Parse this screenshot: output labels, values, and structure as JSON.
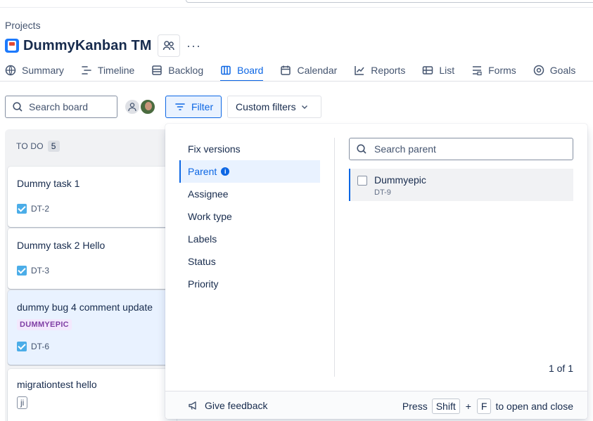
{
  "header": {
    "breadcrumb": "Projects",
    "project_title": "DummyKanban TM",
    "more_label": "···"
  },
  "tabs": [
    {
      "label": "Summary",
      "icon": "globe-icon"
    },
    {
      "label": "Timeline",
      "icon": "timeline-icon"
    },
    {
      "label": "Backlog",
      "icon": "backlog-icon"
    },
    {
      "label": "Board",
      "icon": "board-icon",
      "active": true
    },
    {
      "label": "Calendar",
      "icon": "calendar-icon"
    },
    {
      "label": "Reports",
      "icon": "chart-line-icon"
    },
    {
      "label": "List",
      "icon": "list-icon"
    },
    {
      "label": "Forms",
      "icon": "forms-icon"
    },
    {
      "label": "Goals",
      "icon": "target-icon"
    }
  ],
  "toolbar": {
    "search_placeholder": "Search board",
    "filter_label": "Filter",
    "custom_filters_label": "Custom filters"
  },
  "column": {
    "name": "TO DO",
    "count": "5",
    "cards": [
      {
        "title": "Dummy task 1",
        "key": "DT-2"
      },
      {
        "title": "Dummy task 2 Hello",
        "key": "DT-3"
      },
      {
        "title": "dummy bug 4 comment update",
        "epic": "DUMMYEPIC",
        "key": "DT-6"
      },
      {
        "title": "migrationtest hello",
        "label": "ji"
      }
    ]
  },
  "filter_panel": {
    "menu": [
      {
        "label": "Fix versions"
      },
      {
        "label": "Parent",
        "active": true
      },
      {
        "label": "Assignee"
      },
      {
        "label": "Work type"
      },
      {
        "label": "Labels"
      },
      {
        "label": "Status"
      },
      {
        "label": "Priority"
      }
    ],
    "search_placeholder": "Search parent",
    "options": [
      {
        "name": "Dummyepic",
        "key": "DT-9"
      }
    ],
    "pagination": "1 of 1",
    "feedback_label": "Give feedback",
    "shortcut": {
      "press": "Press",
      "key1": "Shift",
      "plus": "+",
      "key2": "F",
      "suffix": "to open and close"
    }
  },
  "colors": {
    "accent": "#0c66e4",
    "accent_bg": "#e9f2ff",
    "column_bg": "#f1f2f4",
    "epic_bg": "#f3e8fd",
    "epic_text": "#803fa5",
    "task_icon": "#4bade8"
  }
}
